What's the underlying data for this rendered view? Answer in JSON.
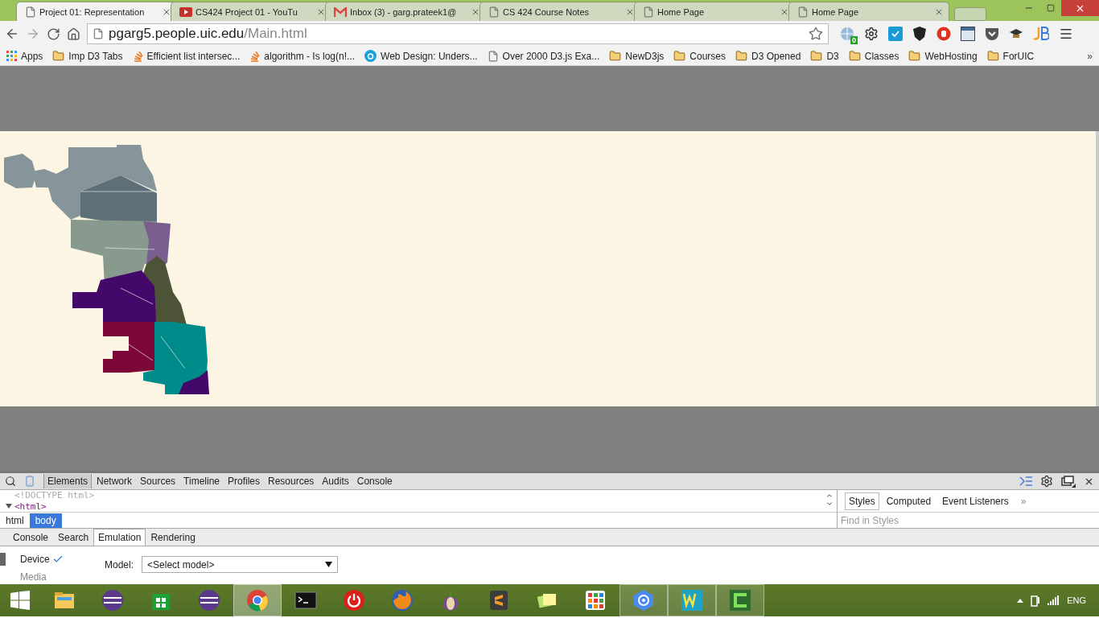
{
  "tabs": [
    {
      "title": "Project 01: Representation",
      "kind": "page",
      "selected": true
    },
    {
      "title": "CS424 Project 01 - YouTu",
      "kind": "video",
      "selected": false
    },
    {
      "title": "Inbox (3) - garg.prateek1@",
      "kind": "mail",
      "selected": false
    },
    {
      "title": "CS 424 Course Notes",
      "kind": "page",
      "selected": false
    },
    {
      "title": "Home Page",
      "kind": "page",
      "selected": false
    },
    {
      "title": "Home Page",
      "kind": "page",
      "selected": false
    }
  ],
  "address": {
    "host": "pgarg5.people.uic.edu",
    "path": "/Main.html"
  },
  "extension_badge": "0",
  "bookmarks": [
    {
      "label": "Apps",
      "kind": "apps"
    },
    {
      "label": "Imp D3 Tabs",
      "kind": "folder"
    },
    {
      "label": "Efficient list intersec...",
      "kind": "stack"
    },
    {
      "label": "algorithm - Is log(n!...",
      "kind": "stack"
    },
    {
      "label": "Web Design: Unders...",
      "kind": "circle"
    },
    {
      "label": "Over 2000 D3.js Exa...",
      "kind": "page"
    },
    {
      "label": "NewD3js",
      "kind": "folder"
    },
    {
      "label": "Courses",
      "kind": "folder"
    },
    {
      "label": "D3 Opened",
      "kind": "folder"
    },
    {
      "label": "D3",
      "kind": "folder"
    },
    {
      "label": "Classes",
      "kind": "folder"
    },
    {
      "label": "WebHosting",
      "kind": "folder"
    },
    {
      "label": "ForUIC",
      "kind": "folder"
    }
  ],
  "bookmarks_more": "»",
  "devtools": {
    "panels": [
      {
        "label": "Elements",
        "selected": true
      },
      {
        "label": "Network",
        "selected": false
      },
      {
        "label": "Sources",
        "selected": false
      },
      {
        "label": "Timeline",
        "selected": false
      },
      {
        "label": "Profiles",
        "selected": false
      },
      {
        "label": "Resources",
        "selected": false
      },
      {
        "label": "Audits",
        "selected": false
      },
      {
        "label": "Console",
        "selected": false
      }
    ],
    "dom_lines": [
      {
        "text": "<!DOCTYPE html>",
        "kind": "doctype"
      },
      {
        "text": "<html>",
        "kind": "tag",
        "expanded": true
      }
    ],
    "breadcrumbs": [
      {
        "label": "html",
        "selected": false
      },
      {
        "label": "body",
        "selected": true
      }
    ],
    "sidebar_tabs": [
      {
        "label": "Styles",
        "selected": true
      },
      {
        "label": "Computed",
        "selected": false
      },
      {
        "label": "Event Listeners",
        "selected": false
      }
    ],
    "sidebar_more": "»",
    "styles_filter": {
      "placeholder": "Find in Styles"
    },
    "drawer_tabs": [
      {
        "label": "Console",
        "selected": false
      },
      {
        "label": "Search",
        "selected": false
      },
      {
        "label": "Emulation",
        "selected": true
      },
      {
        "label": "Rendering",
        "selected": false
      }
    ],
    "emulation_sections": [
      {
        "label": "Device",
        "selected": true,
        "checked": true
      },
      {
        "label": "Media",
        "selected": false,
        "checked": false
      }
    ],
    "model": {
      "label": "Model:",
      "value": "<Select model>"
    }
  },
  "taskbar": {
    "apps": [
      {
        "kind": "files",
        "selected": false,
        "running": false
      },
      {
        "kind": "eclipse",
        "selected": false,
        "running": false
      },
      {
        "kind": "store",
        "selected": false,
        "running": false
      },
      {
        "kind": "eclipse",
        "selected": false,
        "running": false
      },
      {
        "kind": "chrome",
        "selected": true,
        "running": true
      },
      {
        "kind": "terminal",
        "selected": false,
        "running": false
      },
      {
        "kind": "power",
        "selected": false,
        "running": false
      },
      {
        "kind": "firefox",
        "selected": false,
        "running": false
      },
      {
        "kind": "onion",
        "selected": false,
        "running": false
      },
      {
        "kind": "sublime",
        "selected": false,
        "running": false
      },
      {
        "kind": "notes",
        "selected": false,
        "running": false
      },
      {
        "kind": "grid",
        "selected": false,
        "running": false
      },
      {
        "kind": "target",
        "selected": false,
        "running": true
      },
      {
        "kind": "webstorm",
        "selected": false,
        "running": true
      },
      {
        "kind": "camtasia",
        "selected": false,
        "running": true
      }
    ],
    "language": "ENG"
  }
}
